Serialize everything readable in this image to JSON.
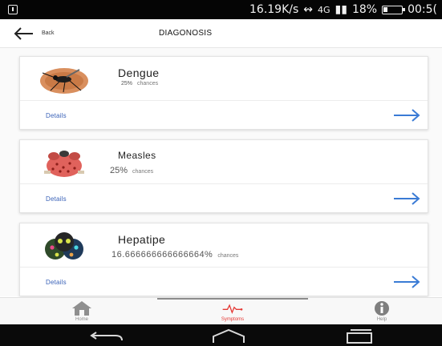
{
  "status_bar": {
    "speed": "16.19K/s",
    "network": "4G",
    "battery_pct": "18%",
    "time": "00:5("
  },
  "header": {
    "back_label": "Back",
    "title": "DIAGONOSIS"
  },
  "diagnoses": [
    {
      "name": "Dengue",
      "chance_value": "25%",
      "chance_word": "chances",
      "details_label": "Details"
    },
    {
      "name": "Measles",
      "chance_value": "25%",
      "chance_word": "chances",
      "details_label": "Details"
    },
    {
      "name": "Hepatipe",
      "chance_value": "16.666666666666664%",
      "chance_word": "chances",
      "details_label": "Details"
    }
  ],
  "tabs": [
    {
      "label": "Home"
    },
    {
      "label": "Symptoms",
      "active": true
    },
    {
      "label": "Help"
    }
  ],
  "colors": {
    "accent_blue": "#3a7bd5",
    "active_red": "#e53935",
    "tab_inactive": "#8a8a8a"
  },
  "icons": {
    "back": "arrow-left-icon",
    "details": "arrow-right-icon",
    "home": "house-icon",
    "symptoms": "heartbeat-icon",
    "help": "info-icon"
  }
}
